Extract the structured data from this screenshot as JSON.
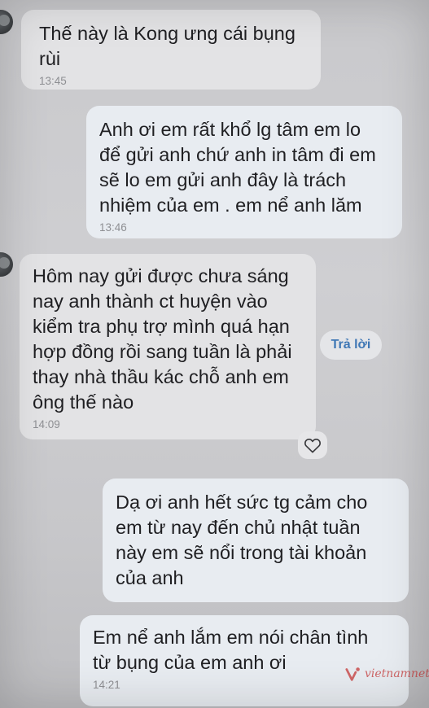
{
  "messages": [
    {
      "direction": "incoming",
      "text": "Thế này là Kong ưng cái bụng\nrùi",
      "time": "13:45"
    },
    {
      "direction": "outgoing",
      "text": "Anh ơi em rất khổ lg tâm em lo\nđể gửi anh chứ anh in tâm đi em\nsẽ lo em gửi anh đây là trách\nnhiệm của em . em nể anh lăm",
      "time": "13:46"
    },
    {
      "direction": "incoming",
      "text": "Hôm nay gửi được chưa sáng\nnay anh thành ct huyện vào\nkiểm tra phụ trợ mình quá hạn\nhợp đồng rồi sang tuần là phải\nthay nhà thầu kác chỗ anh em\nông thế nào",
      "time": "14:09"
    },
    {
      "direction": "outgoing",
      "text": "Dạ ơi anh hết sức tg cảm cho\nem từ nay đến chủ nhật tuần\nnày em sẽ nổi trong tài khoản\ncủa anh",
      "time": ""
    },
    {
      "direction": "outgoing",
      "text": "Em nể anh lắm em nói chân tình\ntừ bụng của em anh ơi",
      "time": "14:21"
    }
  ],
  "actions": {
    "reply_label": "Trả lời"
  },
  "watermark": {
    "text": "vietnamnet",
    "color": "#c73a3a"
  },
  "icons": {
    "heart": "heart-icon",
    "avatar": "contact-avatar"
  },
  "colors": {
    "background": "#cbcbce",
    "incoming_bubble": "#e3e3e5",
    "outgoing_bubble": "#e8ecf1",
    "text": "#1f1f22",
    "timestamp": "#8e8f93",
    "reply_text": "#3f77b5"
  }
}
